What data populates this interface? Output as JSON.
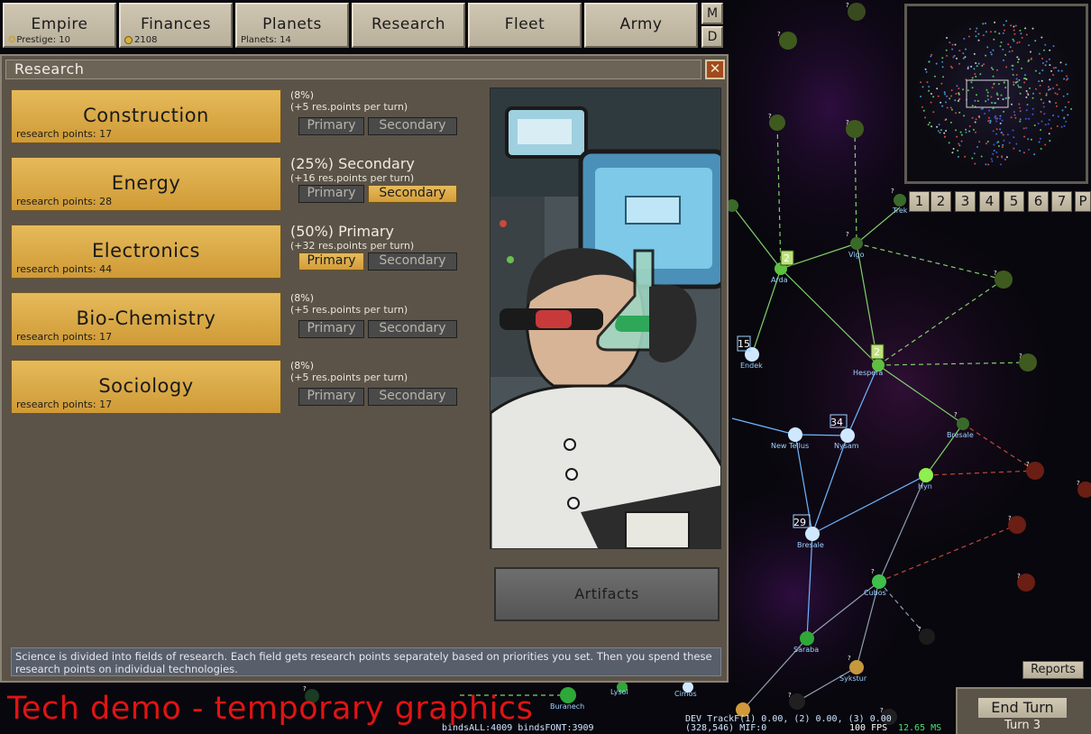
{
  "top_tabs": [
    {
      "label": "Empire",
      "sub": "Prestige: 10",
      "icon": "star-icon"
    },
    {
      "label": "Finances",
      "sub": "2108",
      "icon": "coin-icon"
    },
    {
      "label": "Planets",
      "sub": "Planets: 14"
    },
    {
      "label": "Research",
      "sub": ""
    },
    {
      "label": "Fleet",
      "sub": ""
    },
    {
      "label": "Army",
      "sub": ""
    }
  ],
  "mini_buttons": [
    "M",
    "D"
  ],
  "panel": {
    "title": "Research",
    "close_label": "✕",
    "fields": [
      {
        "name": "Construction",
        "points": "research points: 17",
        "percent": "(8%)",
        "priority_text": "",
        "per_turn": "(+5 res.points per turn)",
        "primary": "Primary",
        "secondary": "Secondary",
        "active": ""
      },
      {
        "name": "Energy",
        "points": "research points: 28",
        "percent": "(25%)",
        "priority_text": "Secondary",
        "per_turn": "(+16 res.points per turn)",
        "primary": "Primary",
        "secondary": "Secondary",
        "active": "secondary"
      },
      {
        "name": "Electronics",
        "points": "research points: 44",
        "percent": "(50%)",
        "priority_text": "Primary",
        "per_turn": "(+32 res.points per turn)",
        "primary": "Primary",
        "secondary": "Secondary",
        "active": "primary"
      },
      {
        "name": "Bio-Chemistry",
        "points": "research points: 17",
        "percent": "(8%)",
        "priority_text": "",
        "per_turn": "(+5 res.points per turn)",
        "primary": "Primary",
        "secondary": "Secondary",
        "active": ""
      },
      {
        "name": "Sociology",
        "points": "research points: 17",
        "percent": "(8%)",
        "priority_text": "",
        "per_turn": "(+5 res.points per turn)",
        "primary": "Primary",
        "secondary": "Secondary",
        "active": ""
      }
    ],
    "artifacts_label": "Artifacts",
    "info_text": "Science is divided into fields of research. Each field gets research points separately based on priorities you set. Then you spend these research points on individual technologies."
  },
  "minimap": {
    "view_buttons": [
      "1",
      "2",
      "3",
      "4",
      "5",
      "6",
      "7",
      "P"
    ]
  },
  "map": {
    "systems": [
      "Arda",
      "Vigo",
      "Endek",
      "Hespera",
      "New Tellus",
      "Nysam",
      "Bresale",
      "Hyn",
      "Bresale",
      "Cubos",
      "Saraba",
      "Sykstur",
      "Buranech",
      "Lysol",
      "Cimos",
      "Trek"
    ],
    "fleet_counts": [
      "2",
      "2",
      "15",
      "34",
      "29"
    ]
  },
  "bottom": {
    "reports_label": "Reports",
    "end_turn_label": "End Turn",
    "turn_label": "Turn 3",
    "tech_demo_text": "Tech demo - temporary graphics",
    "debug_binds": "bindsALL:4009 bindsFONT:3909",
    "debug_track_1": "DEV TrackF(1) 0.00, (2) 0.00, (3) 0.00",
    "debug_track_2": "(328,546)   MIF:0",
    "fps": "100 FPS",
    "ms": "12.65 MS"
  },
  "colors": {
    "field_gold": "#dcae4a",
    "panel_bg": "#5b5348",
    "tech_demo_red": "#e01414",
    "link_green": "#7fd06a",
    "link_blue": "#6fb6ff",
    "link_red": "#c24a36"
  }
}
